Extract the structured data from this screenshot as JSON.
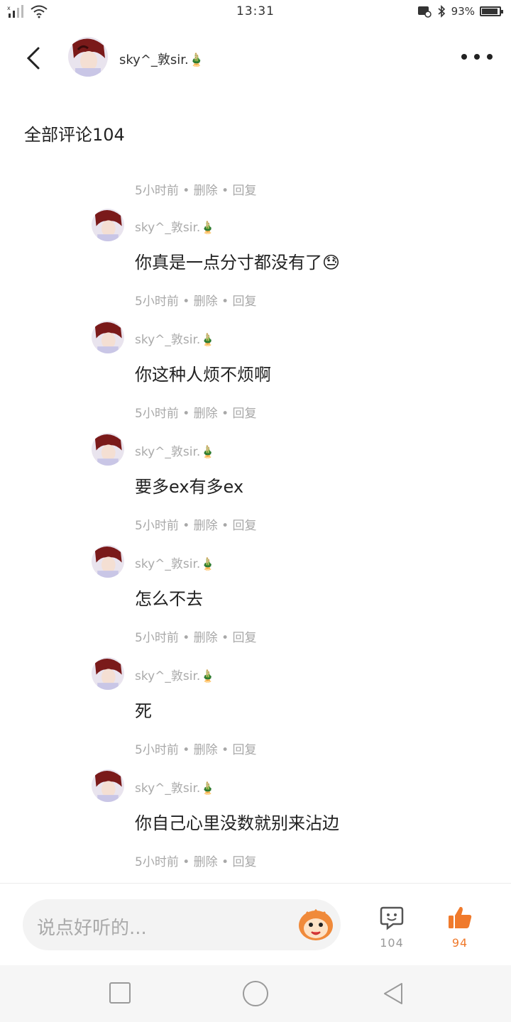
{
  "status_bar": {
    "time": "13:31",
    "battery_percent": "93%",
    "battery_level": 0.93
  },
  "header": {
    "username": "sky^_敦sir.🎍"
  },
  "section": {
    "title": "全部评论104"
  },
  "top_meta": {
    "time": "5小时前",
    "delete": "删除",
    "reply": "回复"
  },
  "comments": [
    {
      "user": "sky^_敦sir.🎍",
      "text": "你真是一点分寸都没有了😓",
      "time": "5小时前",
      "delete": "删除",
      "reply": "回复"
    },
    {
      "user": "sky^_敦sir.🎍",
      "text": "你这种人烦不烦啊",
      "time": "5小时前",
      "delete": "删除",
      "reply": "回复"
    },
    {
      "user": "sky^_敦sir.🎍",
      "text": "要多ex有多ex",
      "time": "5小时前",
      "delete": "删除",
      "reply": "回复"
    },
    {
      "user": "sky^_敦sir.🎍",
      "text": "怎么不去",
      "time": "5小时前",
      "delete": "删除",
      "reply": "回复"
    },
    {
      "user": "sky^_敦sir.🎍",
      "text": "死",
      "time": "5小时前",
      "delete": "删除",
      "reply": "回复"
    },
    {
      "user": "sky^_敦sir.🎍",
      "text": "你自己心里没数就别来沾边",
      "time": "5小时前",
      "delete": "删除",
      "reply": "回复"
    }
  ],
  "bottom_bar": {
    "input_placeholder": "说点好听的...",
    "comment_count": "104",
    "like_count": "94"
  },
  "colors": {
    "like_accent": "#f07a2c",
    "meta_gray": "#a8a8a8",
    "text_dark": "#222222"
  },
  "icons": {
    "back": "chevron-left-icon",
    "more": "more-dots-icon",
    "emoji": "monkey-emoji-icon",
    "comment": "comment-bubble-icon",
    "like": "thumbs-up-icon"
  }
}
